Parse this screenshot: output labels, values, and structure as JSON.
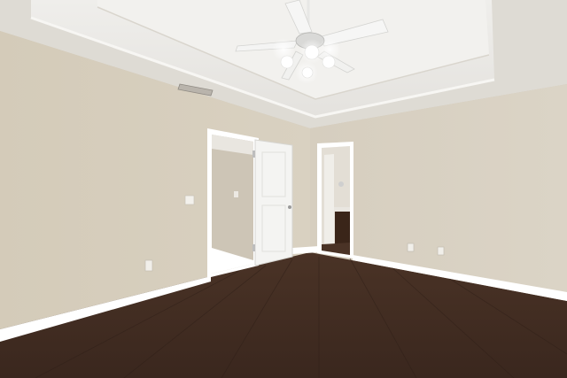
{
  "scene": {
    "colors": {
      "wall_left": "#d3cab9",
      "wall_back": "#d8d0c1",
      "ceiling": "#ebe9e5",
      "tray": "#f4f3f1",
      "trim": "#ffffff",
      "floor_dark": "#3b2820",
      "floor_mid": "#4d3527",
      "door": "#f3f3f1",
      "hall_wall": "#cfc7b8",
      "bath_wall": "#e5e1d9",
      "cabinet": "#3a2519"
    },
    "objects": [
      {
        "name": "ceiling-fan"
      },
      {
        "name": "air-vent"
      },
      {
        "name": "open-doorway-hall"
      },
      {
        "name": "open-door"
      },
      {
        "name": "doorway-bathroom"
      },
      {
        "name": "light-switch"
      },
      {
        "name": "power-outlet"
      },
      {
        "name": "hardwood-floor"
      },
      {
        "name": "baseboard"
      }
    ]
  }
}
